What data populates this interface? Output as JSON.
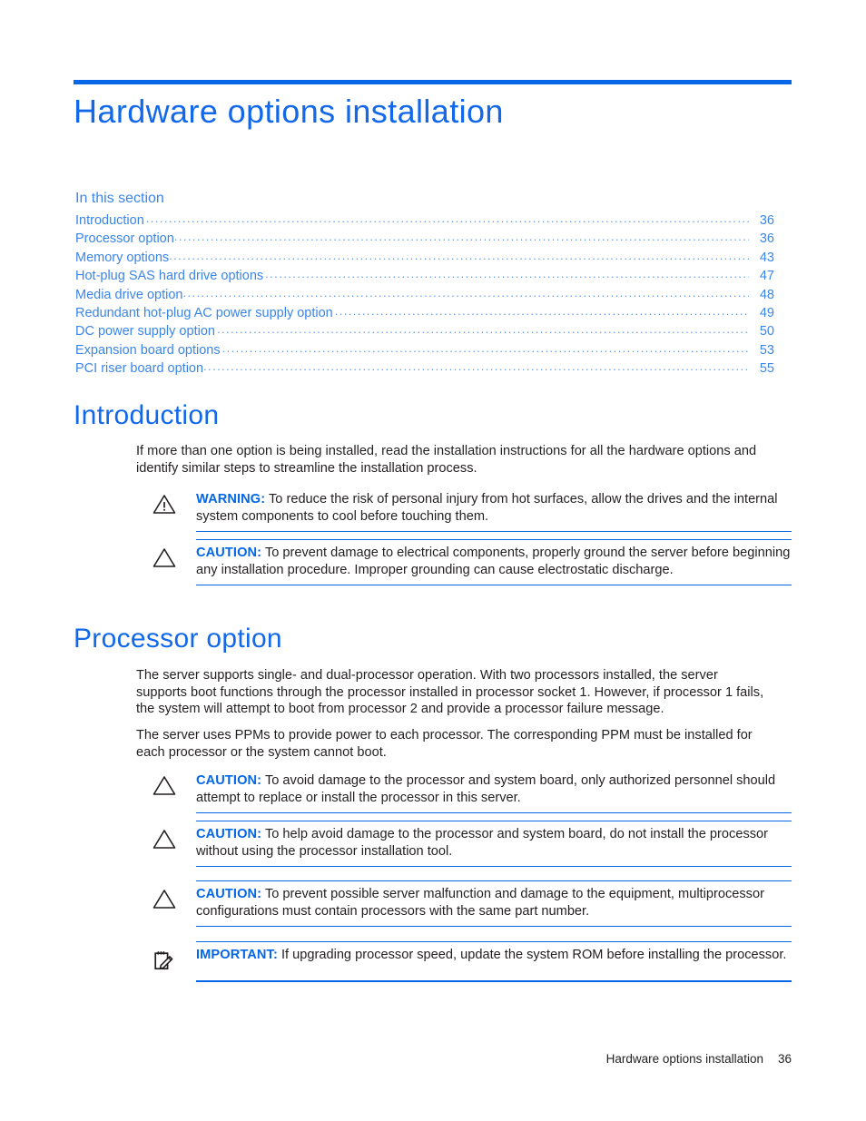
{
  "document": {
    "chapter_title": "Hardware options installation",
    "footer": {
      "text": "Hardware options installation",
      "page_number": "36"
    },
    "accent_color": "#0566e8",
    "heading_color": "#1268e8",
    "toc_color": "#3c85e8"
  },
  "toc": {
    "heading": "In this section",
    "entries": [
      {
        "label": "Introduction",
        "page": "36"
      },
      {
        "label": "Processor option",
        "page": "36"
      },
      {
        "label": "Memory options",
        "page": "43"
      },
      {
        "label": "Hot-plug SAS hard drive options",
        "page": "47"
      },
      {
        "label": "Media drive option",
        "page": "48"
      },
      {
        "label": "Redundant hot-plug AC power supply option",
        "page": "49"
      },
      {
        "label": "DC power supply option",
        "page": "50"
      },
      {
        "label": "Expansion board options",
        "page": "53"
      },
      {
        "label": "PCI riser board option",
        "page": "55"
      }
    ]
  },
  "sections": [
    {
      "id": "introduction",
      "title": "Introduction",
      "paragraphs": [
        "If more than one option is being installed, read the installation instructions for all the hardware options and identify similar steps to streamline the installation process."
      ],
      "notices": [
        {
          "icon": "warning-triangle-exclamation-icon",
          "keyword": "WARNING:",
          "text": "To reduce the risk of personal injury from hot surfaces, allow the drives and the internal system components to cool before touching them."
        },
        {
          "icon": "caution-triangle-icon",
          "keyword": "CAUTION:",
          "text": "To prevent damage to electrical components, properly ground the server before beginning any installation procedure. Improper grounding can cause electrostatic discharge."
        }
      ]
    },
    {
      "id": "processor",
      "title": "Processor option",
      "paragraphs": [
        "The server supports single- and dual-processor operation. With two processors installed, the server supports boot functions through the processor installed in processor socket 1. However, if processor 1 fails, the system will attempt to boot from processor 2 and provide a processor failure message.",
        "The server uses PPMs to provide power to each processor. The corresponding PPM must be installed for each processor or the system cannot boot."
      ],
      "notices": [
        {
          "icon": "caution-triangle-icon",
          "keyword": "CAUTION:",
          "text": "To avoid damage to the processor and system board, only authorized personnel should attempt to replace or install the processor in this server."
        },
        {
          "icon": "caution-triangle-icon",
          "keyword": "CAUTION:",
          "text": "To help avoid damage to the processor and system board, do not install the processor without using the processor installation tool."
        },
        {
          "icon": "caution-triangle-icon",
          "keyword": "CAUTION:",
          "text": "To prevent possible server malfunction and damage to the equipment, multiprocessor configurations must contain processors with the same part number."
        },
        {
          "icon": "important-notepad-pencil-icon",
          "keyword": "IMPORTANT:",
          "text": "If upgrading processor speed, update the system ROM before installing the processor."
        }
      ]
    }
  ]
}
